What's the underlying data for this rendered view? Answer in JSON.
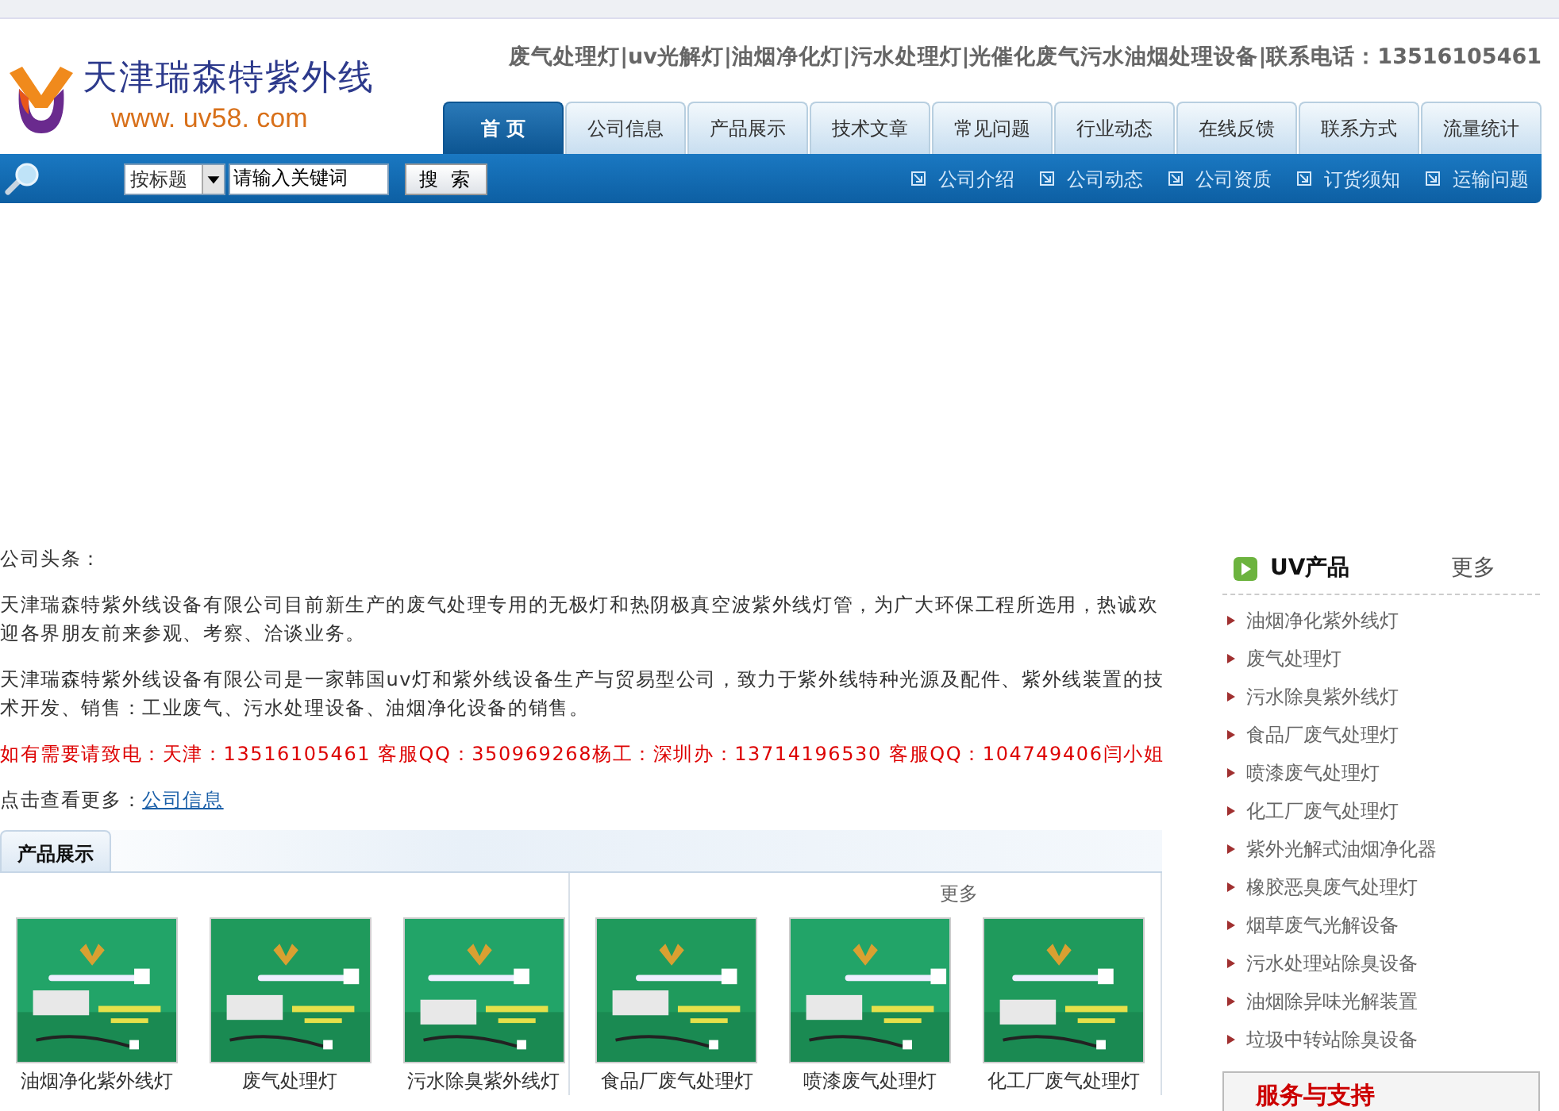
{
  "header": {
    "logo_title": "天津瑞森特紫外线",
    "logo_url": "www. uv58. com",
    "tagline": "废气处理灯|uv光解灯|油烟净化灯|污水处理灯|光催化废气污水油烟处理设备|联系电话：13516105461"
  },
  "nav_tabs": [
    {
      "label": "首 页",
      "selected": true
    },
    {
      "label": "公司信息",
      "selected": false
    },
    {
      "label": "产品展示",
      "selected": false
    },
    {
      "label": "技术文章",
      "selected": false
    },
    {
      "label": "常见问题",
      "selected": false
    },
    {
      "label": "行业动态",
      "selected": false
    },
    {
      "label": "在线反馈",
      "selected": false
    },
    {
      "label": "联系方式",
      "selected": false
    },
    {
      "label": "流量统计",
      "selected": false
    }
  ],
  "search": {
    "scope": "按标题",
    "value": "请输入关键词",
    "button": "搜 索"
  },
  "quick_links": [
    "公司介绍",
    "公司动态",
    "公司资质",
    "订货须知",
    "运输问题"
  ],
  "news": {
    "title": "公司头条：",
    "paragraphs": [
      "天津瑞森特紫外线设备有限公司目前新生产的废气处理专用的无极灯和热阴极真空波紫外线灯管，为广大环保工程所选用，热诚欢迎各界朋友前来参观、考察、洽谈业务。",
      "天津瑞森特紫外线设备有限公司是一家韩国uv灯和紫外线设备生产与贸易型公司，致力于紫外线特种光源及配件、紫外线装置的技术开发、销售：工业废气、污水处理设备、油烟净化设备的销售。"
    ],
    "contact": "如有需要请致电：天津：13516105461 客服QQ：350969268杨工：深圳办：13714196530 客服QQ：104749406闫小姐",
    "more_label": "点击查看更多：",
    "more_link": "公司信息"
  },
  "products": {
    "tab": "产品展示",
    "more": "更多",
    "items": [
      {
        "caption": "油烟净化紫外线灯",
        "kind": "picture"
      },
      {
        "caption": "废气处理灯",
        "kind": "picture"
      },
      {
        "caption": "污水除臭紫外线灯",
        "kind": "picture"
      },
      {
        "caption": "食品厂废气处理灯",
        "kind": "picture"
      },
      {
        "caption": "喷漆废气处理灯",
        "kind": "picture"
      },
      {
        "caption": "化工厂废气处理灯",
        "kind": "picture"
      }
    ]
  },
  "sidebar": {
    "title": "UV产品",
    "more": "更多",
    "items": [
      "油烟净化紫外线灯",
      "废气处理灯",
      "污水除臭紫外线灯",
      "食品厂废气处理灯",
      "喷漆废气处理灯",
      "化工厂废气处理灯",
      "紫外光解式油烟净化器",
      "橡胶恶臭废气处理灯",
      "烟草废气光解设备",
      "污水处理站除臭设备",
      "油烟除异味光解装置",
      "垃圾中转站除臭设备"
    ]
  },
  "support": {
    "title": "服务与支持"
  }
}
